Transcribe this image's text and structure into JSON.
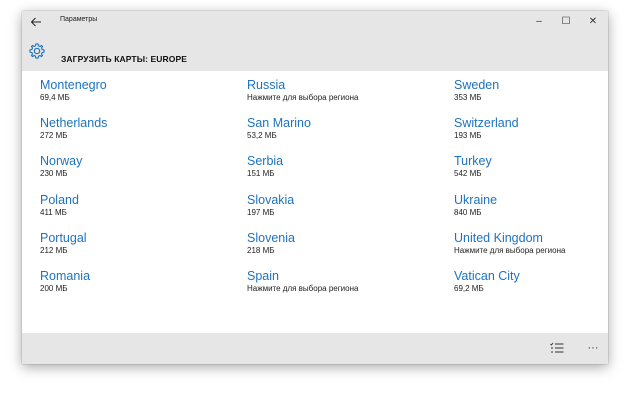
{
  "window": {
    "app_title": "Параметры",
    "back_icon": "back-arrow-icon",
    "controls": {
      "minimize": "–",
      "maximize": "☐",
      "close": "✕"
    }
  },
  "header": {
    "icon": "gear-icon",
    "title": "ЗАГРУЗИТЬ КАРТЫ: EUROPE"
  },
  "columns": [
    [
      {
        "name": "Montenegro",
        "size": "69,4 МБ"
      },
      {
        "name": "Netherlands",
        "size": "272 МБ"
      },
      {
        "name": "Norway",
        "size": "230 МБ"
      },
      {
        "name": "Poland",
        "size": "411 МБ"
      },
      {
        "name": "Portugal",
        "size": "212 МБ"
      },
      {
        "name": "Romania",
        "size": "200 МБ"
      }
    ],
    [
      {
        "name": "Russia",
        "size": "Нажмите для выбора региона"
      },
      {
        "name": "San Marino",
        "size": "53,2 МБ"
      },
      {
        "name": "Serbia",
        "size": "151 МБ"
      },
      {
        "name": "Slovakia",
        "size": "197 МБ"
      },
      {
        "name": "Slovenia",
        "size": "218 МБ"
      },
      {
        "name": "Spain",
        "size": "Нажмите для выбора региона"
      }
    ],
    [
      {
        "name": "Sweden",
        "size": "353 МБ"
      },
      {
        "name": "Switzerland",
        "size": "193 МБ"
      },
      {
        "name": "Turkey",
        "size": "542 МБ"
      },
      {
        "name": "Ukraine",
        "size": "840 МБ"
      },
      {
        "name": "United Kingdom",
        "size": "Нажмите для выбора региона"
      },
      {
        "name": "Vatican City",
        "size": "69,2 МБ"
      }
    ]
  ],
  "bottombar": {
    "select_icon": "checklist-icon",
    "more_icon": "more-icon",
    "more_label": "···"
  },
  "colors": {
    "accent": "#1e73be",
    "chrome": "#e6e6e6"
  }
}
